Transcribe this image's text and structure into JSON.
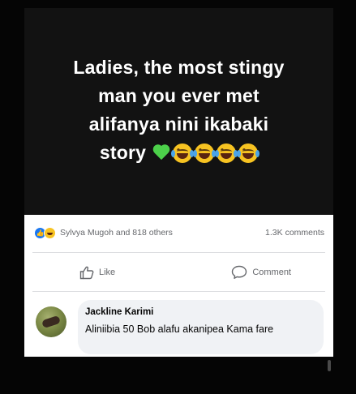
{
  "post": {
    "image_text_lines": [
      "Ladies, the most stingy",
      "man you ever met",
      "alifanya nini ikabaki",
      "story"
    ],
    "image_emojis": [
      "green-heart",
      "tears-of-joy",
      "tears-of-joy",
      "tears-of-joy",
      "tears-of-joy"
    ]
  },
  "stats": {
    "reactions_text": "Sylvya Mugoh and 818 others",
    "comments_text": "1.3K comments",
    "reaction_icons": [
      "like",
      "haha"
    ]
  },
  "actions": {
    "like_label": "Like",
    "comment_label": "Comment"
  },
  "comment": {
    "author": "Jackline Karimi",
    "text": "Aliniibia 50 Bob alafu akanipea Kama fare"
  },
  "colors": {
    "post_background": "#121212",
    "headline_text": "#ffffff",
    "muted_text": "#65676b",
    "bubble": "#f0f2f5",
    "like_blue": "#1877f2"
  }
}
